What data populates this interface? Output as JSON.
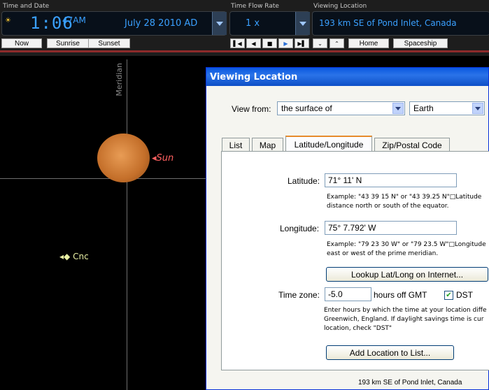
{
  "toolbar": {
    "time_label": "Time and Date",
    "time_value": "1:06",
    "ampm": "47AM",
    "date_value": "July 28   2010 AD",
    "flow_label": "Time Flow Rate",
    "flow_value": "1 x",
    "location_label": "Viewing Location",
    "location_value": "193 km SE of Pond Inlet, Canada",
    "now": "Now",
    "sunrise": "Sunrise",
    "sunset": "Sunset",
    "home": "Home",
    "spaceship": "Spaceship"
  },
  "sky": {
    "meridian": "Meridian",
    "sun_label": "Sun",
    "cnc_label": "Cnc"
  },
  "dialog": {
    "title": "Viewing Location",
    "view_from_label": "View from:",
    "view_from_value": "the surface of",
    "planet_value": "Earth",
    "tabs": [
      "List",
      "Map",
      "Latitude/Longitude",
      "Zip/Postal Code"
    ],
    "latitude_label": "Latitude:",
    "latitude_value": "71° 11' N",
    "latitude_help_1": "Example: \"43 39 15 N\" or \"43 39.25 N\"□Latitude",
    "latitude_help_2": "distance north or south of the equator.",
    "longitude_label": "Longitude:",
    "longitude_value": "75° 7.792' W",
    "longitude_help_1": "Example: \"79 23 30 W\" or \"79 23.5 W\"□Longitude",
    "longitude_help_2": "east or west of the prime meridian.",
    "lookup_button": "Lookup Lat/Long on Internet...",
    "timezone_label": "Time zone:",
    "timezone_value": "-5.0",
    "hours_off": "hours off GMT",
    "dst_label": "DST",
    "tz_help_1": "Enter hours by which the time at your location diffe",
    "tz_help_2": "Greenwich, England. If daylight savings time is cur",
    "tz_help_3": "location, check \"DST\"",
    "add_button": "Add Location to List...",
    "status": "193 km SE of Pond Inlet, Canada"
  }
}
